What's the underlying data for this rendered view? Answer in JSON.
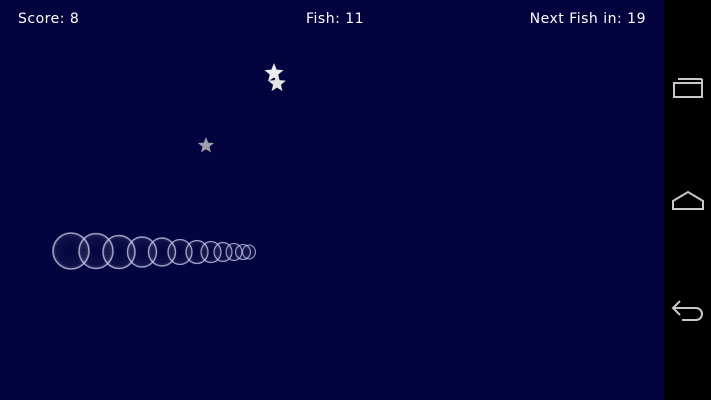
{
  "hud": {
    "score_text": "Score: 8",
    "fish_text": "Fish: 11",
    "next_fish_text": "Next Fish in: 19"
  },
  "game": {
    "background_color": "#03033f",
    "stars": [
      {
        "name": "star-bright-1",
        "color": "#e8e8e8"
      },
      {
        "name": "star-bright-2",
        "color": "#e8e8e8"
      },
      {
        "name": "star-dim",
        "color": "#9a9aa8"
      }
    ],
    "fish_trail_color": "#c9ccee",
    "fish_trail_rings": 12
  },
  "navigation_bar": {
    "background_color": "#000000",
    "buttons": [
      "recent-apps-icon",
      "home-icon",
      "back-icon"
    ]
  }
}
